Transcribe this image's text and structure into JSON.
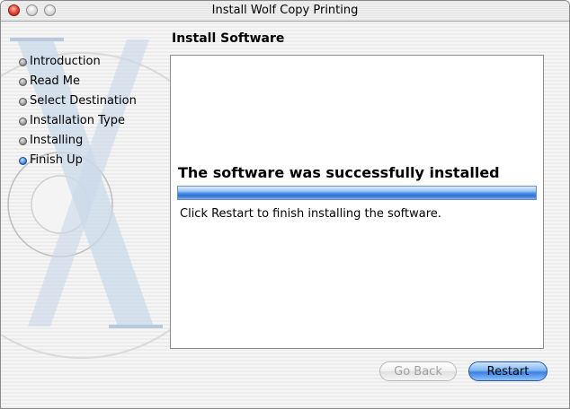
{
  "window": {
    "title": "Install Wolf Copy Printing"
  },
  "heading": "Install Software",
  "steps": [
    {
      "label": "Introduction",
      "active": false
    },
    {
      "label": "Read Me",
      "active": false
    },
    {
      "label": "Select Destination",
      "active": false
    },
    {
      "label": "Installation Type",
      "active": false
    },
    {
      "label": "Installing",
      "active": false
    },
    {
      "label": "Finish Up",
      "active": true
    }
  ],
  "content": {
    "success_title": "The software was successfully installed",
    "progress": 1.0,
    "message": "Click Restart to finish installing the software."
  },
  "buttons": {
    "back_label": "Go Back",
    "back_enabled": false,
    "restart_label": "Restart"
  },
  "colors": {
    "accent": "#3b7fe0",
    "disabled_text": "#a0a0a0"
  }
}
